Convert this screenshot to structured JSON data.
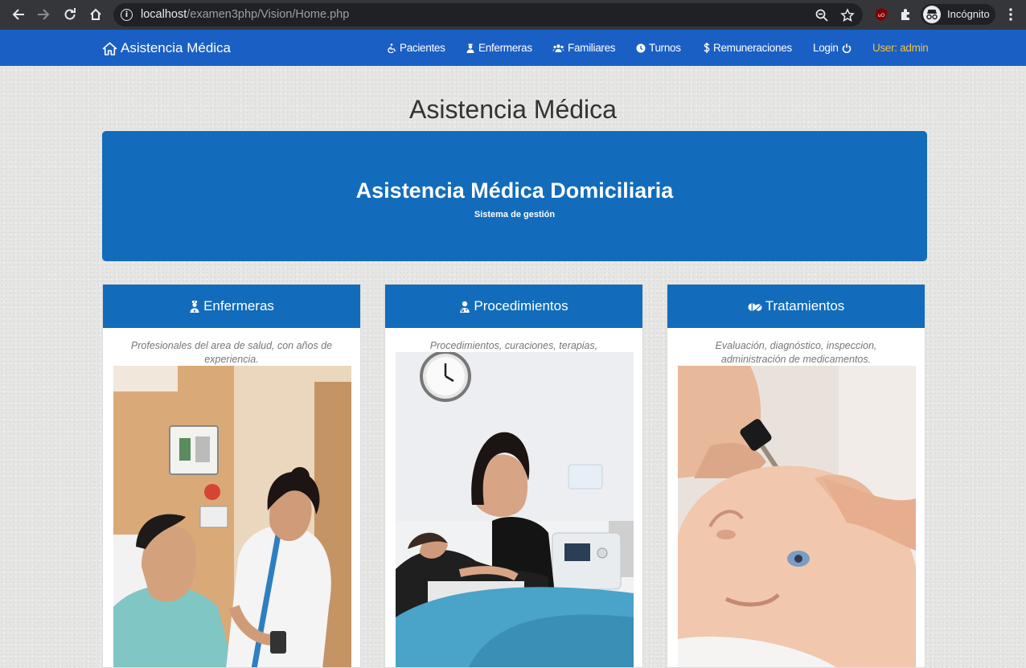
{
  "browser": {
    "url_host": "localhost",
    "url_path": "/examen3php/Vision/Home.php",
    "profile_label": "Incógnito"
  },
  "navbar": {
    "brand": "Asistencia Médica",
    "links": [
      {
        "label": "Pacientes",
        "icon": "wheelchair-icon"
      },
      {
        "label": "Enfermeras",
        "icon": "nurse-icon"
      },
      {
        "label": "Familiares",
        "icon": "users-icon"
      },
      {
        "label": "Turnos",
        "icon": "clock-icon"
      },
      {
        "label": "Remuneraciones",
        "icon": "dollar-icon"
      },
      {
        "label": "Login",
        "icon": "power-icon"
      }
    ],
    "user": "User: admin"
  },
  "main": {
    "title": "Asistencia Médica",
    "jumbotron": {
      "title": "Asistencia Médica Domiciliaria",
      "subtitle": "Sistema de gestión"
    },
    "cards": [
      {
        "title": "Enfermeras",
        "icon": "nurse-icon",
        "description": "Profesionales del area de salud, con años de experiencia."
      },
      {
        "title": "Procedimientos",
        "icon": "doctor-icon",
        "description": "Procedimientos, curaciones, terapias, rehabilitación."
      },
      {
        "title": "Tratamientos",
        "icon": "pills-icon",
        "description": "Evaluación, diagnóstico, inspeccion, administración de medicamentos."
      }
    ]
  },
  "colors": {
    "navbar": "#1a5fc4",
    "primary": "#126cbb",
    "user_accent": "#f0c040"
  }
}
